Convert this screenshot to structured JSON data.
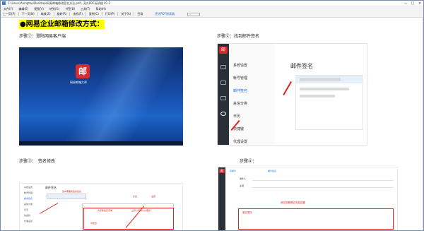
{
  "window": {
    "title": "C:\\Users\\Alongtop\\Desktop\\网易邮箱修改签名方法.pdf - 亮光PDF阅读器 V1.2",
    "controls": [
      "—",
      "□",
      "✕"
    ]
  },
  "menu": [
    "文件(F)",
    "编辑(E)",
    "视图(V)",
    "转到(G)",
    "书签(B)",
    "工具(T)",
    "帮助(H)"
  ],
  "toolbar": {
    "buttons": [
      "上一页(P)",
      "下一页(N)",
      "缩放(Z)",
      "旋转(R)",
      "查找(F)",
      "复制(C)",
      "打印(P)",
      "关于(A)",
      "目录"
    ],
    "brand": "亮光PDF阅读器"
  },
  "document": {
    "heading": "●网易企业邮箱修改方式：",
    "step1": {
      "label": "步骤①：登陆网易客户端",
      "app_icon": "邮",
      "app_label": "网易邮箱大师"
    },
    "step2": {
      "label": "步骤②：找到邮件签名",
      "side_logo": "邮",
      "nav": [
        "系统设置",
        "帐号管理",
        "邮件签名",
        "来信分类",
        "日历",
        "快捷键",
        "代理设置"
      ],
      "active_nav": "邮件签名",
      "main_title": "邮件签名"
    },
    "step3": {
      "label": "步骤③：　签名修改",
      "title": "邮件签名",
      "nav": [
        "系统设置",
        "帐号管理",
        "邮件签名",
        "来信分类",
        "日历",
        "快捷键",
        "代理设置"
      ],
      "red_notes": [
        "选中需要修改的签名",
        "点击",
        "设置",
        "文字修改及字体",
        "可修改",
        "上传公司的logo图片"
      ]
    },
    "step4": {
      "label": "步骤④：",
      "side_logo": "邮",
      "tabs": [
        "写邮件",
        "邮件签名"
      ],
      "fields": [
        "收件人",
        "主题"
      ],
      "red_note": "测试查看是否完成设置",
      "sig_note": "签名展示"
    }
  },
  "colors": {
    "heading_highlight": "#ffff00",
    "brand_red": "#d82b2b",
    "annotation_red": "#e02020",
    "link_blue": "#1a73d9"
  }
}
